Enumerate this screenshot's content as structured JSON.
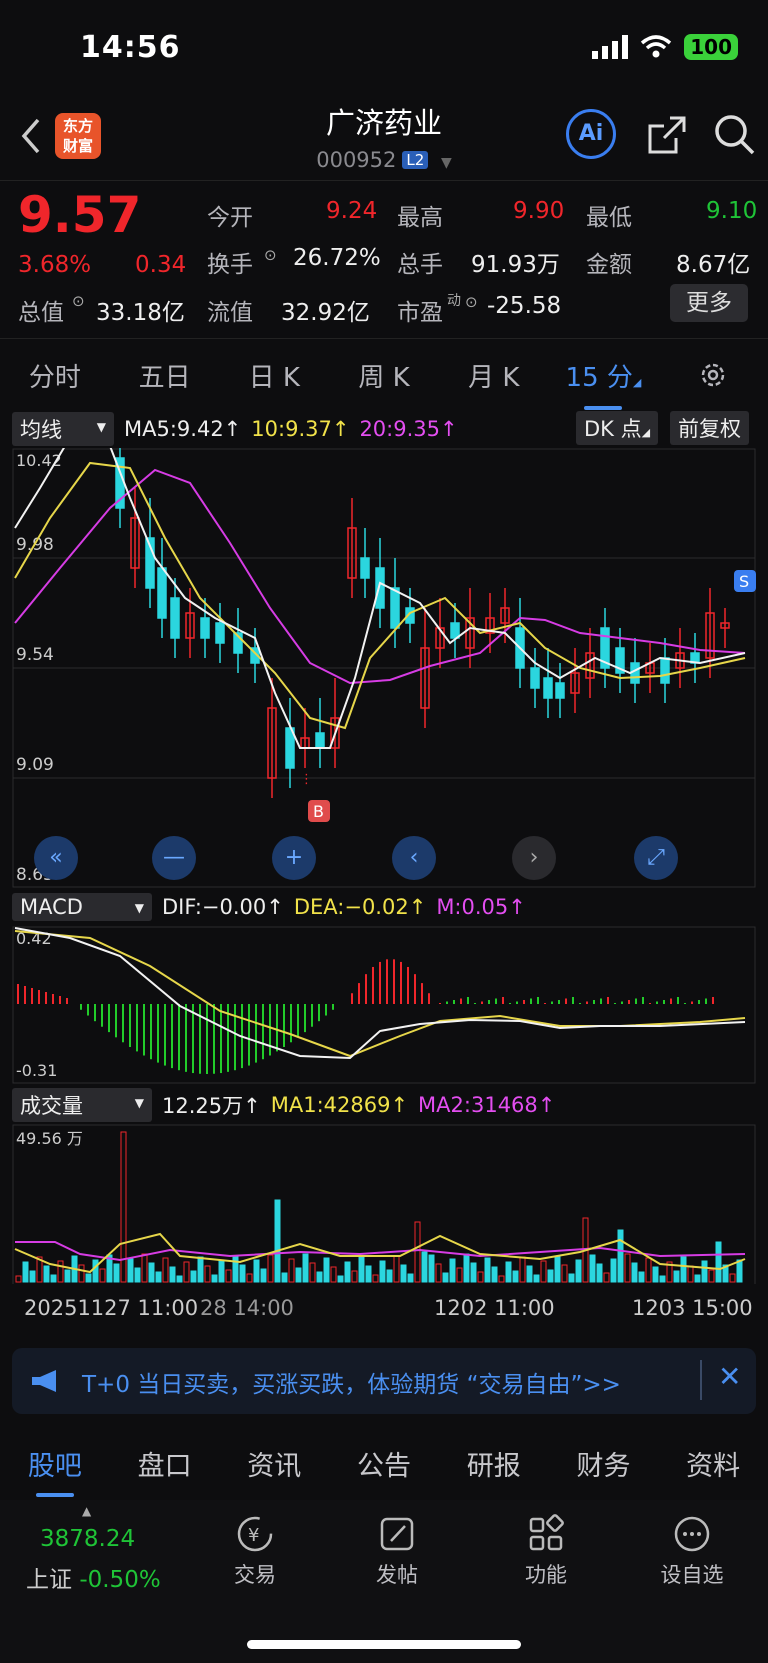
{
  "status": {
    "time": "14:56",
    "battery": "100"
  },
  "header": {
    "title": "广济药业",
    "code": "000952",
    "level": "L2",
    "logo_line1": "东方",
    "logo_line2": "财富"
  },
  "quote": {
    "price": "9.57",
    "change_pct": "3.68%",
    "change": "0.34",
    "open_label": "今开",
    "open": "9.24",
    "high_label": "最高",
    "high": "9.90",
    "low_label": "最低",
    "low": "9.10",
    "turnover_label": "换手",
    "turnover": "26.72%",
    "volume_label": "总手",
    "volume": "91.93万",
    "amount_label": "金额",
    "amount": "8.67亿",
    "mcap_label": "总值",
    "mcap": "33.18亿",
    "float_label": "流值",
    "float": "32.92亿",
    "pe_label": "市盈",
    "pe_sup": "动",
    "pe": "-25.58",
    "more": "更多"
  },
  "tabs": [
    "分时",
    "五日",
    "日 K",
    "周 K",
    "月 K",
    "15 分",
    "settings"
  ],
  "active_tab": "15 分",
  "ma_bar": {
    "select": "均线",
    "ma5": "MA5:9.42↑",
    "ma10": "10:9.37↑",
    "ma20": "20:9.35↑",
    "dk": "DK 点",
    "adjust": "前复权"
  },
  "kline": {
    "y_labels": [
      "10.42",
      "9.98",
      "9.54",
      "9.09",
      "8.65"
    ],
    "buy_marker": "B",
    "sell_marker": "S"
  },
  "macd_bar": {
    "select": "MACD",
    "dif": "DIF:−0.00↑",
    "dea": "DEA:−0.02↑",
    "m": "M:0.05↑",
    "y_top": "0.42",
    "y_bottom": "-0.31"
  },
  "vol_bar": {
    "select": "成交量",
    "vol": "12.25万↑",
    "ma1": "MA1:42869↑",
    "ma2": "MA2:31468↑",
    "y_top": "49.56 万"
  },
  "x_axis": [
    "20251127 11:00",
    "28 14:00",
    "1202 11:00",
    "1203 15:00"
  ],
  "banner": {
    "text": "T+0 当日买卖，买涨买跌，体验期货 “交易自由”>>"
  },
  "bottom_tabs": [
    "股吧",
    "盘口",
    "资讯",
    "公告",
    "研报",
    "财务",
    "资料"
  ],
  "dock": {
    "index_value": "3878.24",
    "index_name": "上证",
    "index_change": "-0.50%",
    "trade": "交易",
    "post": "发帖",
    "func": "功能",
    "watch": "设自选"
  },
  "colors": {
    "up": "#f0262b",
    "down": "#1fc437",
    "bear_candle": "#2bd6df",
    "accent": "#4a8ff0"
  }
}
